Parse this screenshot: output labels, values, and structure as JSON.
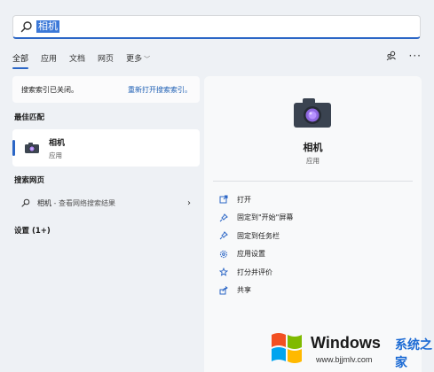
{
  "search": {
    "query": "相机"
  },
  "tabs": [
    {
      "label": "全部",
      "active": true
    },
    {
      "label": "应用"
    },
    {
      "label": "文档"
    },
    {
      "label": "网页"
    },
    {
      "label": "更多"
    }
  ],
  "toolbar_icons": [
    "account-switch-icon",
    "more-options-icon"
  ],
  "notice": {
    "text": "搜索索引已关闭。",
    "link": "重新打开搜索索引。"
  },
  "best_match": {
    "section_title": "最佳匹配",
    "app_name": "相机",
    "app_type": "应用"
  },
  "web_search": {
    "section_title": "搜索网页",
    "query": "相机",
    "suffix": " - 查看网络搜索结果"
  },
  "settings": {
    "label": "设置 (1+)"
  },
  "detail": {
    "app_name": "相机",
    "app_type": "应用",
    "actions": [
      {
        "label": "打开",
        "icon": "open-icon"
      },
      {
        "label": "固定到\"开始\"屏幕",
        "icon": "pin-icon"
      },
      {
        "label": "固定到任务栏",
        "icon": "pin-icon"
      },
      {
        "label": "应用设置",
        "icon": "gear-icon"
      },
      {
        "label": "打分并评价",
        "icon": "star-icon"
      },
      {
        "label": "共享",
        "icon": "share-icon"
      }
    ]
  },
  "watermark": {
    "brand": "Windows",
    "cn": "系统之家",
    "url": "www.bjjmlv.com"
  },
  "colors": {
    "accent": "#2b66c6",
    "link": "#1e5fb4",
    "background": "#eef1f5"
  }
}
